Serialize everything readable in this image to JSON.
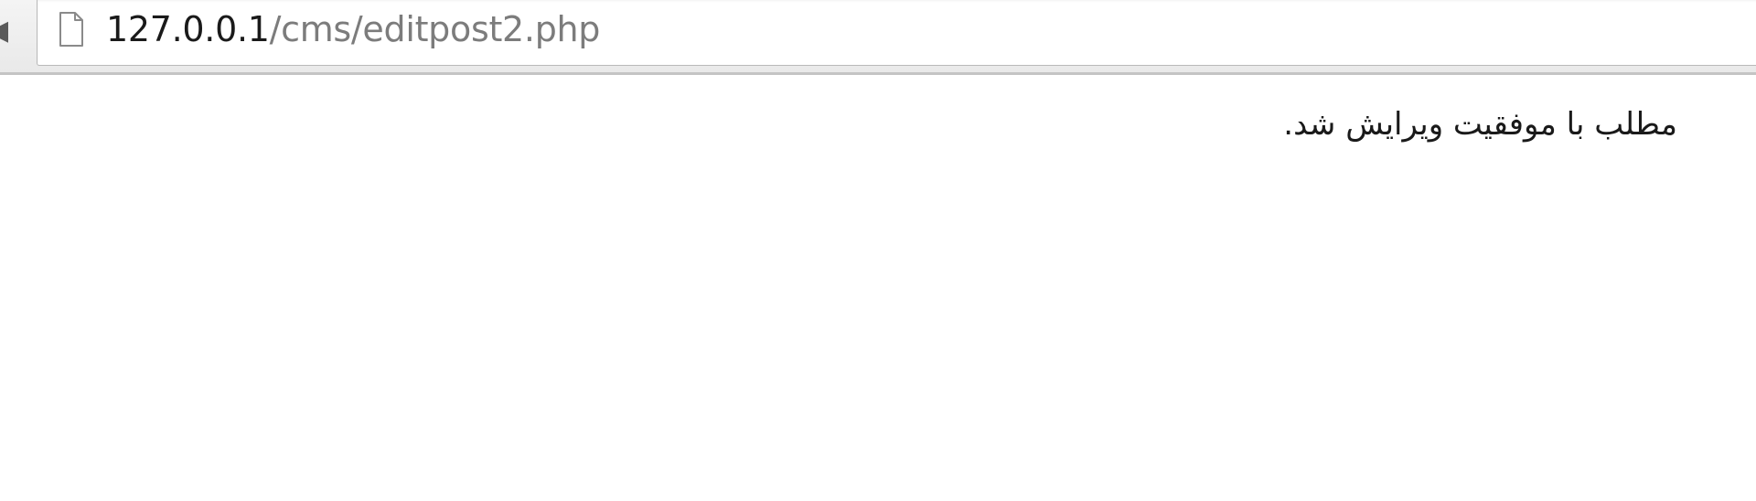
{
  "browser": {
    "back_glyph": "◀",
    "address": {
      "host": "127.0.0.1",
      "path": "/cms/editpost2.php"
    },
    "icons": {
      "nav": "reload-icon",
      "page": "page-icon"
    }
  },
  "page": {
    "message": "مطلب با موفقیت ویرایش شد."
  }
}
